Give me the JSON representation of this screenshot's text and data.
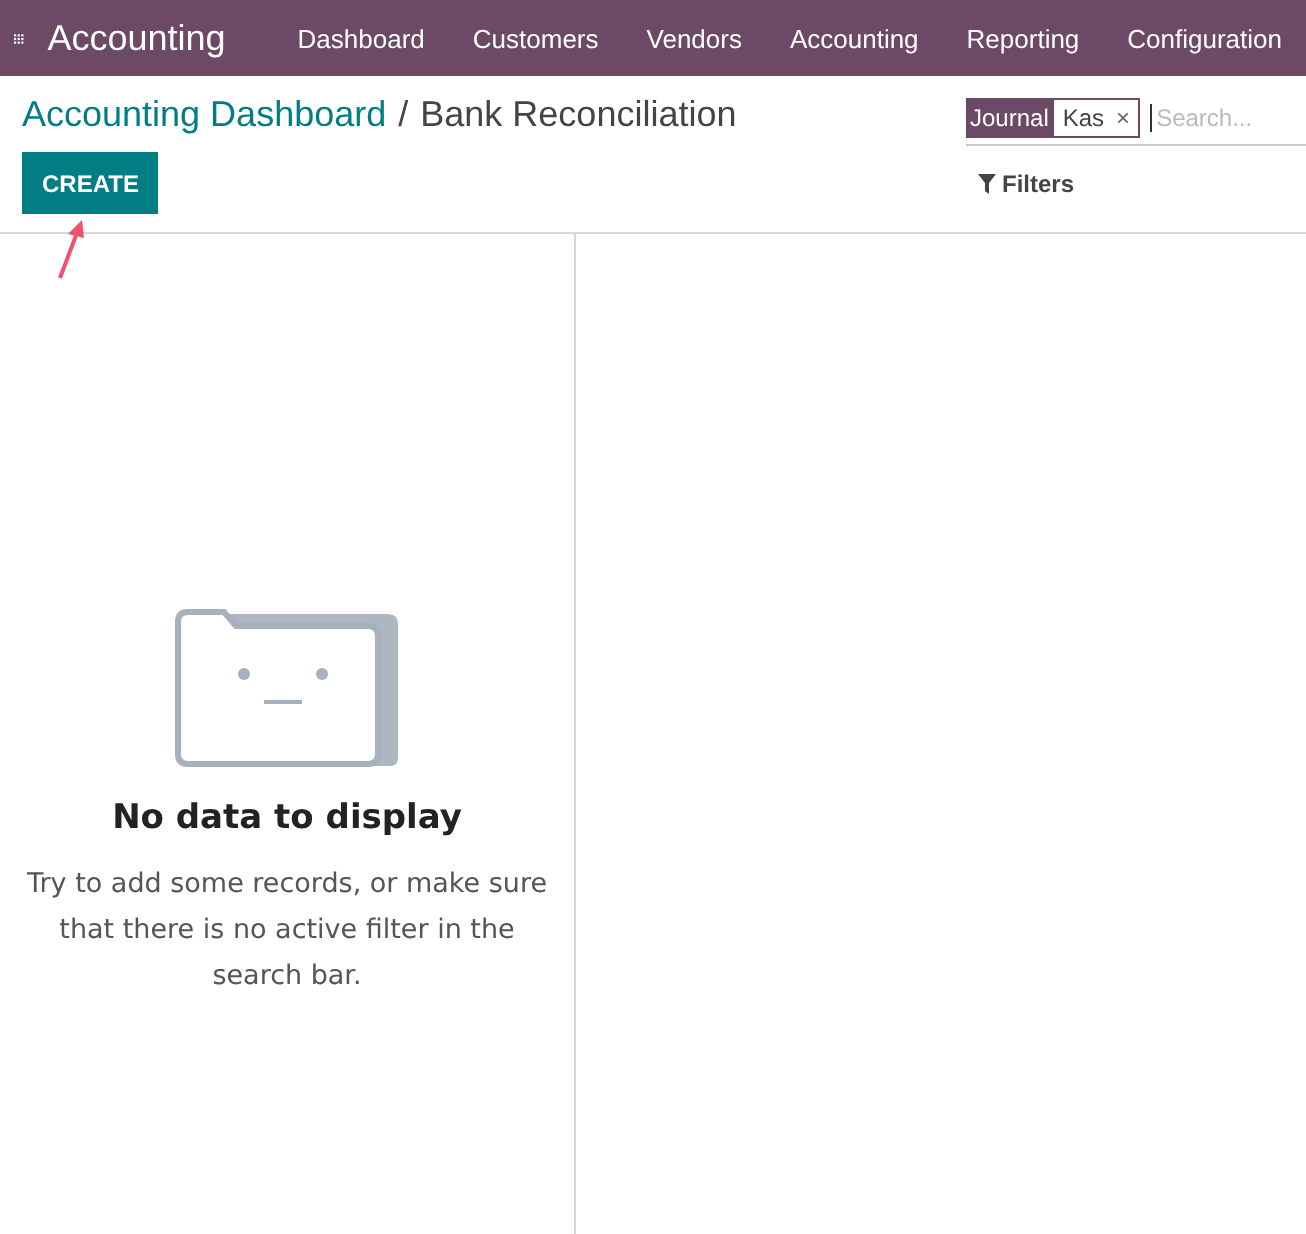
{
  "app": {
    "title": "Accounting"
  },
  "menu": [
    "Dashboard",
    "Customers",
    "Vendors",
    "Accounting",
    "Reporting",
    "Configuration"
  ],
  "breadcrumb": {
    "parent": "Accounting Dashboard",
    "separator": "/",
    "current": "Bank Reconciliation"
  },
  "create_button": "CREATE",
  "search": {
    "facet_label": "Journal",
    "facet_value": "Kas",
    "remove": "×",
    "placeholder": "Search..."
  },
  "filters_button": "Filters",
  "empty_state": {
    "title": "No data to display",
    "message": "Try to add some records, or make sure that there is no active filter in the search bar."
  }
}
